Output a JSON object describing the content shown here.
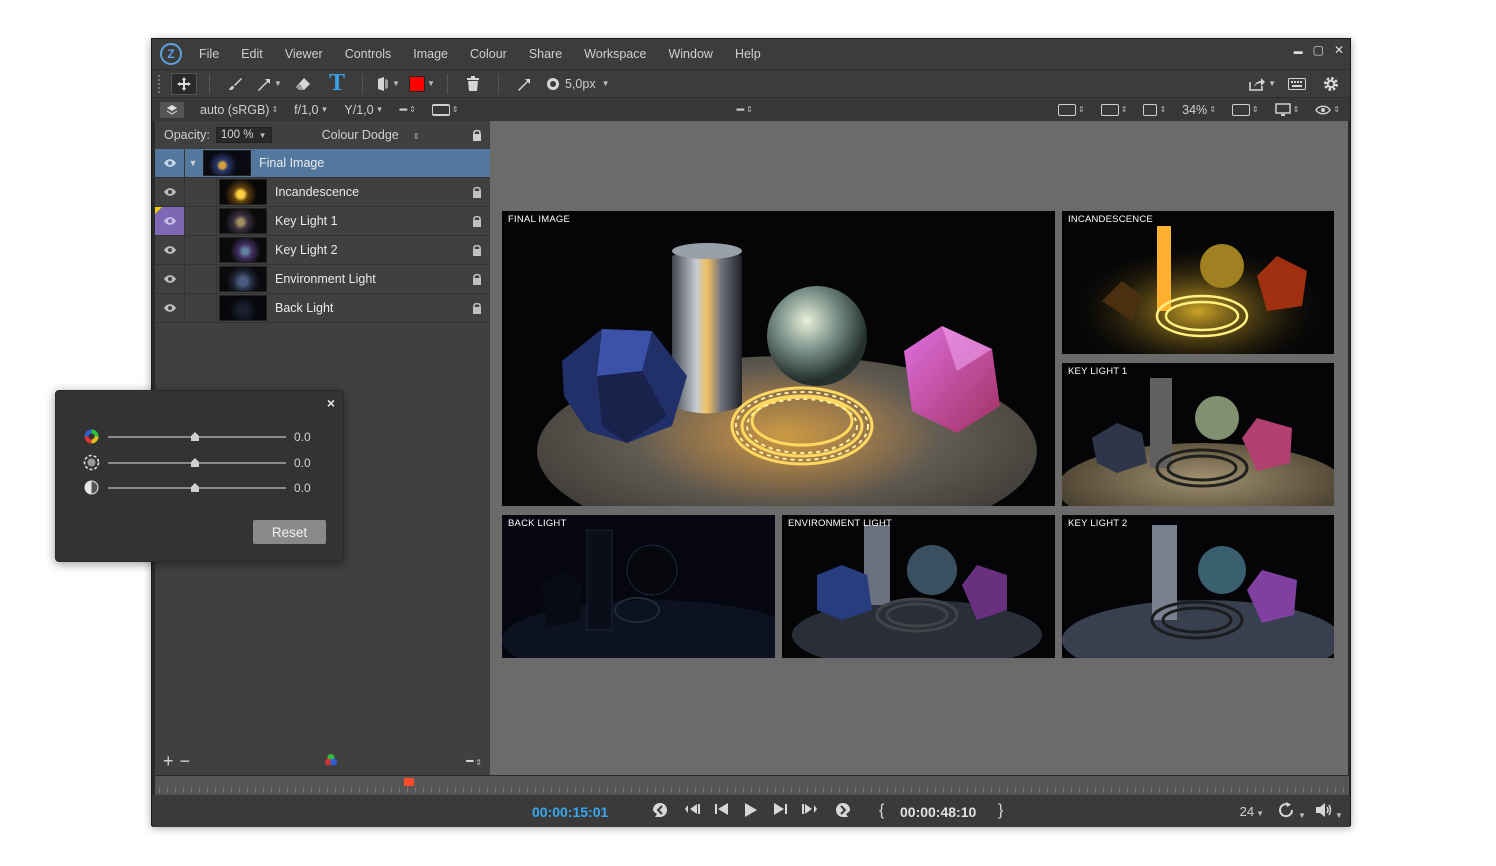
{
  "menu": [
    "File",
    "Edit",
    "Viewer",
    "Controls",
    "Image",
    "Colour",
    "Share",
    "Workspace",
    "Window",
    "Help"
  ],
  "toolbar": {
    "brush_size": "5,0px",
    "text_tool_glyph": "T",
    "colour": "#ff0000"
  },
  "viewerbar": {
    "colourspace": "auto (sRGB)",
    "fstop": "f/1,0",
    "gamma": "Y/1,0",
    "zoom": "34%"
  },
  "layers": {
    "opacity_label": "Opacity:",
    "opacity_value": "100 %",
    "blend_mode": "Colour Dodge",
    "items": [
      {
        "name": "Final Image"
      },
      {
        "name": "Incandescence"
      },
      {
        "name": "Key Light 1"
      },
      {
        "name": "Key Light 2"
      },
      {
        "name": "Environment Light"
      },
      {
        "name": "Back Light"
      }
    ]
  },
  "renders": [
    {
      "label": "FINAL IMAGE"
    },
    {
      "label": "INCANDESCENCE"
    },
    {
      "label": "KEY LIGHT 1"
    },
    {
      "label": "BACK LIGHT"
    },
    {
      "label": "ENVIRONMENT LIGHT"
    },
    {
      "label": "KEY LIGHT 2"
    }
  ],
  "transport": {
    "current_timecode": "00:00:15:01",
    "end_timecode": "00:00:48:10",
    "fps": "24",
    "playhead_fraction": 0.21
  },
  "adjust": {
    "close_glyph": "×",
    "sliders": [
      {
        "icon": "colour-wheel-icon",
        "value": "0.0"
      },
      {
        "icon": "dashed-circle-icon",
        "value": "0.0"
      },
      {
        "icon": "contrast-icon",
        "value": "0.0"
      }
    ],
    "reset_label": "Reset"
  },
  "window": {
    "minimize": "▬",
    "maximize": "▢",
    "close": "✕"
  }
}
